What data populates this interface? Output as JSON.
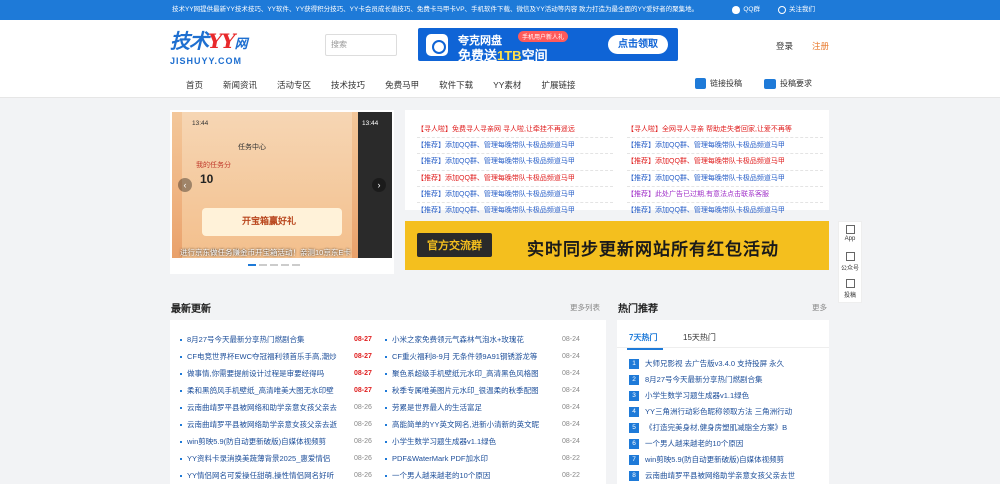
{
  "topbar": {
    "notice": "技术YY网提供最新YY技术技巧、YY软件、YY获得积分技巧、YY卡会员成长值技巧、免费卡马甲卡VP、手机软件下载、微信及YY活动等内容 致力打造为最全面的YY爱好者的聚集地。",
    "qq": "QQ群",
    "follow": "关注我们"
  },
  "header": {
    "logo_cn_a": "技术",
    "logo_cn_b": "YY",
    "logo_cn_c": "网",
    "logo_en": "JISHUYY.COM",
    "search_placeholder": "搜索",
    "login": "登录",
    "register": "注册"
  },
  "banner": {
    "line1": "夸克网盘",
    "tag": "手机用户新人礼",
    "line2a": "免费送",
    "line2b": "1TB",
    "line2c": "空间",
    "button": "点击领取"
  },
  "nav": [
    "首页",
    "新闻资讯",
    "活动专区",
    "技术技巧",
    "免费马甲",
    "软件下载",
    "YY素材",
    "扩展链接"
  ],
  "right_links": {
    "nav": "链接投稿",
    "submit": "投稿要求"
  },
  "slider": {
    "time1": "13:44",
    "title": "任务中心",
    "my_points": "我的任务分",
    "points": "10",
    "chest": "开宝箱赢好礼",
    "time2": "13:44",
    "caption": "进行京东做任务赚金币开宝箱活动！亲测10京东E卡",
    "prev": "‹",
    "next": "›"
  },
  "ads_left": [
    {
      "text": "【寻人啦】免费寻人寻亲网 寻人啦,让牵挂不再遥远",
      "c": "r"
    },
    {
      "text": "【推荐】添加QQ群、管理每晚带队卡极品频道马甲",
      "c": "b"
    },
    {
      "text": "【推荐】添加QQ群、管理每晚带队卡极品频道马甲",
      "c": "b"
    },
    {
      "text": "【推荐】添加QQ群、管理每晚带队卡极品频道马甲",
      "c": "r"
    },
    {
      "text": "【推荐】添加QQ群、管理每晚带队卡极品频道马甲",
      "c": "b"
    },
    {
      "text": "【推荐】添加QQ群、管理每晚带队卡极品频道马甲",
      "c": "b"
    }
  ],
  "ads_right": [
    {
      "text": "【寻人啦】全网寻人寻亲 帮助走失者回家,让爱不再等",
      "c": "r"
    },
    {
      "text": "【推荐】添加QQ群、管理每晚带队卡极品频道马甲",
      "c": "b"
    },
    {
      "text": "【推荐】添加QQ群、管理每晚带队卡极品频道马甲",
      "c": "r"
    },
    {
      "text": "【推荐】添加QQ群、管理每晚带队卡极品频道马甲",
      "c": "b"
    },
    {
      "text": "【推荐】此处广告已过期,有意法点击联系客服",
      "c": "p"
    },
    {
      "text": "【推荐】添加QQ群、管理每晚带队卡极品频道马甲",
      "c": "b"
    }
  ],
  "promo": {
    "left": "官方交流群",
    "main": "实时同步更新网站所有红包活动"
  },
  "float": {
    "app": "App",
    "gzh": "公众号",
    "feedback": "投稿"
  },
  "latest": {
    "title": "最新更新",
    "more": "更多列表"
  },
  "hot": {
    "title": "热门推荐",
    "more": "更多",
    "tab1": "7天热门",
    "tab2": "15天热门"
  },
  "latest_rows": [
    {
      "a": "8月27号今天最新分享热门燃剧合集",
      "ad": "08-27",
      "ar": true,
      "b": "小米之家免费领元气森林气泡水+玫瑰花",
      "bd": "08-24"
    },
    {
      "a": "CF电竞世界杯EWC夺冠福利领首乐手高,潮炒",
      "ad": "08-27",
      "ar": true,
      "b": "CF重火福利8-9月 无条件领9A91钢锈游龙等",
      "bd": "08-24"
    },
    {
      "a": "做事情,你需要提前设计过程是审要经得吗",
      "ad": "08-27",
      "ar": true,
      "b": "聚色系超级手机壁纸元水印_高清黑色风格图",
      "bd": "08-24"
    },
    {
      "a": "柔和黑鸽风手机壁纸_高清唯美大图无水印壁",
      "ad": "08-27",
      "ar": true,
      "b": "秋季专属唯美图片元水印_很温柔的秋季配图",
      "bd": "08-24"
    },
    {
      "a": "云南曲靖罗平县被网络和助学亲意女孩父亲去",
      "ad": "08-26",
      "ar": false,
      "b": "劳累是世界最人的生活富足",
      "bd": "08-24"
    },
    {
      "a": "云南曲靖罗平县被网络助学亲意女孩父亲去逝",
      "ad": "08-26",
      "ar": false,
      "b": "高能简单的YY英文网名,进新小清新的英文昵",
      "bd": "08-24"
    },
    {
      "a": "win剪映5.9(防自动更新破版)自媒体视频剪",
      "ad": "08-26",
      "ar": false,
      "b": "小学生数学习题生成器v1.1绿色",
      "bd": "08-24"
    },
    {
      "a": "YY资料卡录消换美蔬薄背景2025_惠爱情侣",
      "ad": "08-26",
      "ar": false,
      "b": "PDF&WaterMark PDF加水印",
      "bd": "08-22"
    },
    {
      "a": "YY情侣网名可爱操任甜萌,操性情侣网名好听",
      "ad": "08-26",
      "ar": false,
      "b": "一个男人越来越老的10个原因",
      "bd": "08-22"
    }
  ],
  "hot_rows": [
    {
      "n": "1",
      "t": "大师兄影视 去广告版v3.4.0 支持投屏 永久"
    },
    {
      "n": "2",
      "t": "8月27号今天最新分享热门燃剧合集"
    },
    {
      "n": "3",
      "t": "小学生数学习题生成器v1.1绿色"
    },
    {
      "n": "4",
      "t": "YY三角洲行动彩色昵称领取方法 三角洲行动"
    },
    {
      "n": "5",
      "t": "《打造完美身材,健身房塑肌减脂全方案》B"
    },
    {
      "n": "6",
      "t": "一个男人越来越老的10个原因"
    },
    {
      "n": "7",
      "t": "win剪映5.9(防自动更新破版)自媒体视频剪"
    },
    {
      "n": "8",
      "t": "云南曲靖罗平县被网络助学亲意女孩父亲去世"
    }
  ],
  "colors": {
    "primary": "#1e7ad8",
    "promo": "#f4bf1e",
    "red": "#e02020"
  }
}
